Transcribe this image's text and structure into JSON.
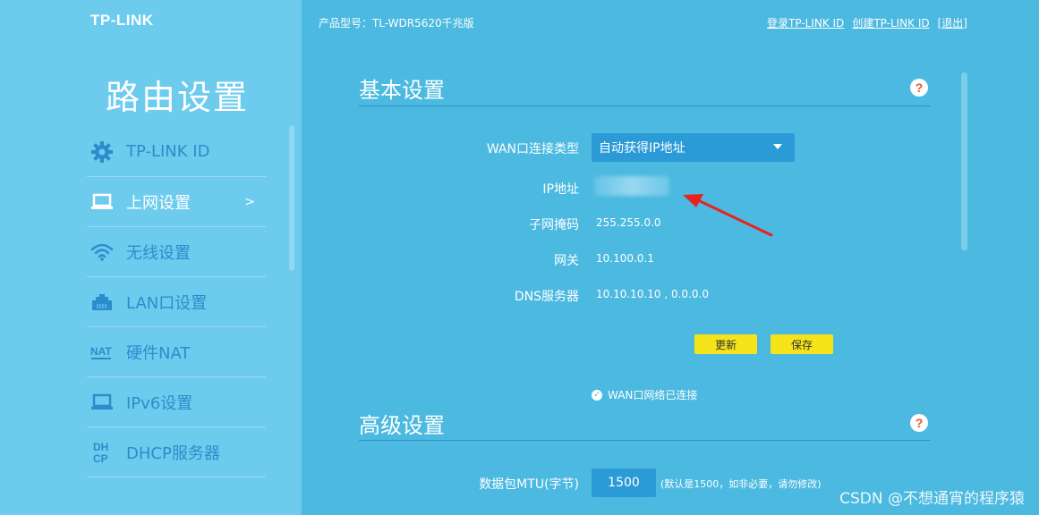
{
  "brand": {
    "logo": "TP-LINK"
  },
  "header": {
    "model": "产品型号：TL-WDR5620千兆版",
    "links": [
      "登录TP-LINK ID",
      "创建TP-LINK ID",
      "[退出]"
    ]
  },
  "sidebar": {
    "title": "路由设置",
    "items": [
      {
        "label": "TP-LINK ID",
        "icon": "gear-icon"
      },
      {
        "label": "上网设置",
        "icon": "laptop-icon",
        "arrow": ">"
      },
      {
        "label": "无线设置",
        "icon": "wifi-icon"
      },
      {
        "label": "LAN口设置",
        "icon": "lan-port-icon"
      },
      {
        "label": "硬件NAT",
        "icon": "nat-icon"
      },
      {
        "label": "IPv6设置",
        "icon": "laptop-icon"
      },
      {
        "label": "DHCP服务器",
        "icon": "dhcp-icon"
      }
    ]
  },
  "basic": {
    "title": "基本设置",
    "help": "?",
    "wan_type_label": "WAN口连接类型",
    "wan_type_value": "自动获得IP地址",
    "ip_label": "IP地址",
    "mask_label": "子网掩码",
    "mask_value": "255.255.0.0",
    "gateway_label": "网关",
    "gateway_value": "10.100.0.1",
    "dns_label": "DNS服务器",
    "dns_value": "10.10.10.10 , 0.0.0.0",
    "refresh_label": "更新",
    "save_label": "保存",
    "status_text": "WAN口网络已连接"
  },
  "advanced": {
    "title": "高级设置",
    "help": "?",
    "mtu_label": "数据包MTU(字节)",
    "mtu_value": "1500",
    "mtu_hint": "(默认是1500，如非必要，请勿修改)"
  },
  "watermark": "CSDN @不想通宵的程序猿",
  "colors": {
    "background": "#4bb9e0",
    "sidebar": "#6dcbee",
    "inactive_nav": "#2c8dcc",
    "button": "#f6e41a",
    "annotation_arrow": "#e8231f"
  }
}
